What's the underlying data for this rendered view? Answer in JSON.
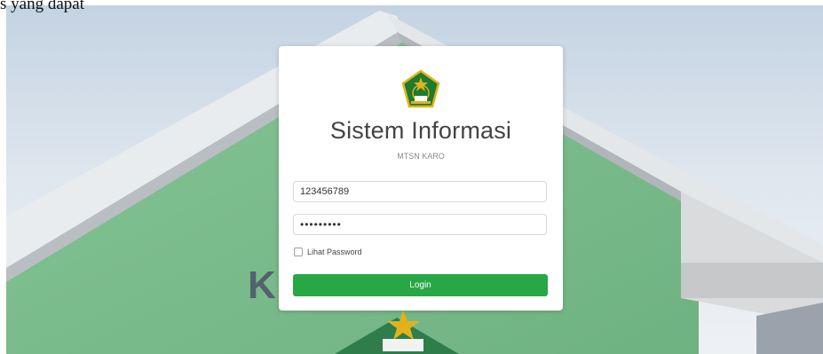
{
  "header_text": "s yang dapat",
  "login": {
    "title": "Sistem Informasi",
    "subtitle": "MTSN KARO",
    "username_value": "123456789",
    "password_value": "•••••••••",
    "show_password_label": "Lihat Password",
    "login_button": "Login"
  },
  "background": {
    "wall_letter": "K"
  },
  "colors": {
    "button": "#28a745",
    "wall": "#7fbf8f",
    "logo_green": "#1f7a2e",
    "logo_gold": "#e2b21c"
  },
  "icons": [
    "ministry-logo-icon",
    "checkbox-icon"
  ]
}
